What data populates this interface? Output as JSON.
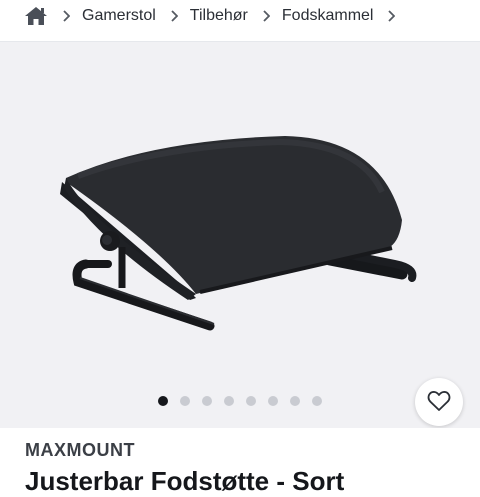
{
  "breadcrumb": {
    "home_icon": "home-icon",
    "items": [
      {
        "label": "Gamerstol"
      },
      {
        "label": "Tilbehør"
      },
      {
        "label": "Fodskammel"
      }
    ]
  },
  "gallery": {
    "image_alt": "Justerbar fodstøtte",
    "image_count": 8,
    "active_index": 0,
    "favorite_icon": "heart-outline-icon"
  },
  "product": {
    "brand": "MAXMOUNT",
    "title": "Justerbar Fodstøtte - Sort"
  },
  "colors": {
    "accent": "#15171b",
    "gallery_bg": "#f1f1f4"
  }
}
